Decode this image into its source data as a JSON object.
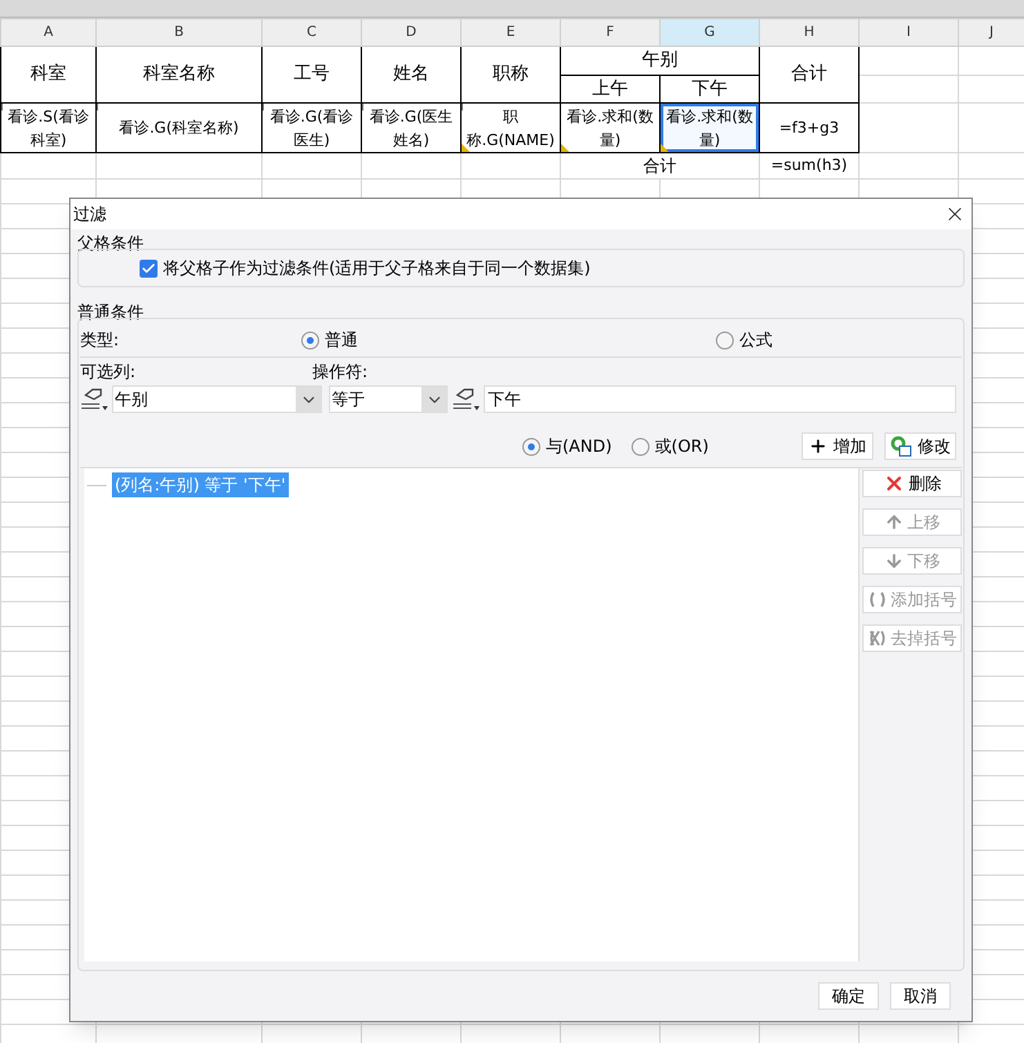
{
  "sheet": {
    "columns": [
      {
        "label": "A",
        "selected": false
      },
      {
        "label": "B",
        "selected": false
      },
      {
        "label": "C",
        "selected": false
      },
      {
        "label": "D",
        "selected": false
      },
      {
        "label": "E",
        "selected": false
      },
      {
        "label": "F",
        "selected": false
      },
      {
        "label": "G",
        "selected": true
      },
      {
        "label": "H",
        "selected": false
      },
      {
        "label": "I",
        "selected": false
      },
      {
        "label": "J",
        "selected": false
      }
    ],
    "header": {
      "department": "科室",
      "department_name": "科室名称",
      "staff_no": "工号",
      "name": "姓名",
      "title": "职称",
      "period": "午别",
      "morning": "上午",
      "afternoon": "下午",
      "total": "合计"
    },
    "data_row": [
      {
        "text": "看诊.S(看诊科室)",
        "expand_arrow": true,
        "marked": false,
        "selected": false
      },
      {
        "text": "看诊.G(科室名称)",
        "expand_arrow": true,
        "marked": false,
        "selected": false
      },
      {
        "text": "看诊.G(看诊医生)",
        "expand_arrow": true,
        "marked": false,
        "selected": false
      },
      {
        "text": "看诊.G(医生姓名)",
        "expand_arrow": true,
        "marked": false,
        "selected": false
      },
      {
        "text": "职称.G(NAME)",
        "expand_arrow": true,
        "marked": true,
        "selected": false
      },
      {
        "text": "看诊.求和(数量)",
        "expand_arrow": false,
        "marked": true,
        "selected": false
      },
      {
        "text": "看诊.求和(数量)",
        "expand_arrow": false,
        "marked": true,
        "selected": true
      },
      {
        "text": "=f3+g3",
        "expand_arrow": false,
        "marked": false,
        "selected": false
      }
    ],
    "total_row": {
      "label": "合计",
      "formula": "=sum(h3)"
    }
  },
  "dialog": {
    "title": "过滤",
    "parent_group": {
      "title": "父格条件",
      "checkbox": {
        "label": "将父格子作为过滤条件(适用于父子格来自于同一个数据集)",
        "checked": true
      }
    },
    "normal_group": {
      "title": "普通条件",
      "type_label": "类型:",
      "types": [
        {
          "label": "普通",
          "selected": true
        },
        {
          "label": "公式",
          "selected": false
        }
      ],
      "column_label": "可选列:",
      "column_value": "午别",
      "operator_label": "操作符:",
      "operator_value": "等于",
      "value": "下午",
      "logic": [
        {
          "label": "与(AND)",
          "selected": true
        },
        {
          "label": "或(OR)",
          "selected": false
        }
      ],
      "add_button": "增加",
      "modify_button": "修改",
      "conditions": [
        {
          "text": "(列名:午别) 等于 '下午'",
          "selected": true
        }
      ],
      "side_buttons": [
        {
          "kind": "delete",
          "label": "删除",
          "disabled": false
        },
        {
          "kind": "up",
          "label": "上移",
          "disabled": true
        },
        {
          "kind": "down",
          "label": "下移",
          "disabled": true
        },
        {
          "kind": "add_brackets",
          "label": "添加括号",
          "disabled": true
        },
        {
          "kind": "remove_brackets",
          "label": "去掉括号",
          "disabled": true
        }
      ]
    },
    "buttons": [
      "确定",
      "取消"
    ]
  }
}
